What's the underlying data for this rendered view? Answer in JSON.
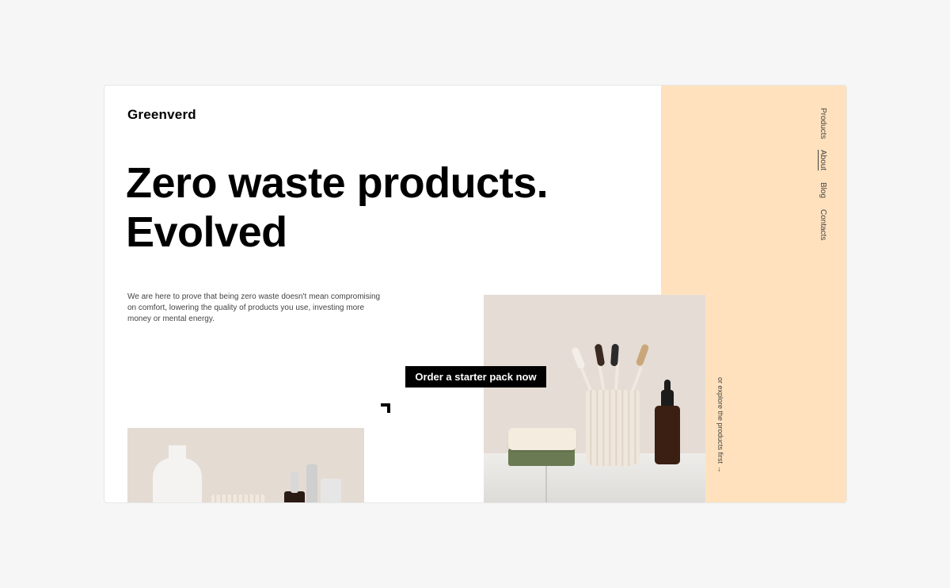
{
  "brand": {
    "name": "Greenverd"
  },
  "hero": {
    "headline_line1": "Zero waste products.",
    "headline_line2": "Evolved",
    "intro": "We are here to prove that being zero waste doesn't mean compromising on comfort, lowering the quality of products you use, investing more money or mental energy.",
    "cta_label": "Order a starter pack now"
  },
  "nav": {
    "items": [
      {
        "label": "Products",
        "active": false
      },
      {
        "label": "About",
        "active": true
      },
      {
        "label": "Blog",
        "active": false
      },
      {
        "label": "Contacts",
        "active": false
      }
    ]
  },
  "explore_link": "or explore the products first →",
  "colors": {
    "page_bg": "#f6f6f6",
    "accent_panel": "#ffe2bd",
    "button_bg": "#000000",
    "button_text": "#ffffff"
  }
}
